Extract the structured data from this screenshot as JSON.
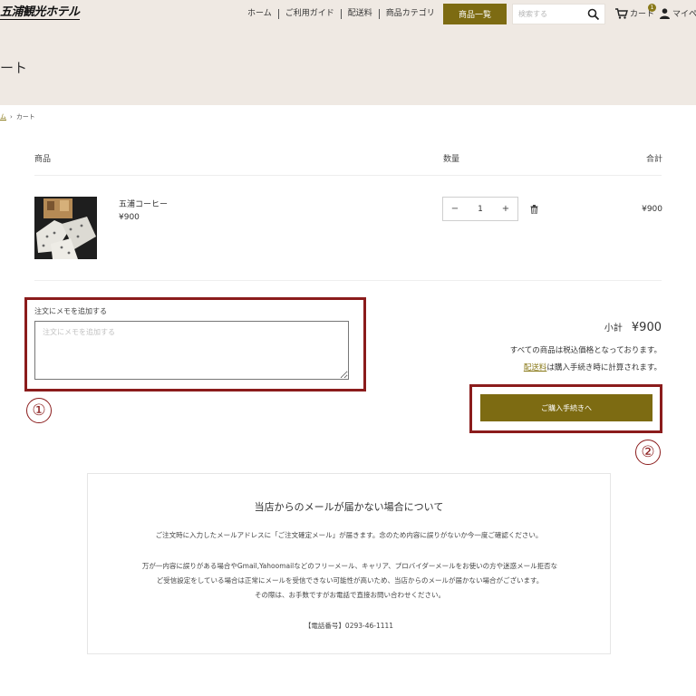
{
  "header": {
    "logo": "五浦観光ホテル",
    "nav": [
      "ホーム",
      "ご利用ガイド",
      "配送料",
      "商品カテゴリ"
    ],
    "category_button": "商品一覧",
    "search_placeholder": "検索する",
    "cart_label": "カート",
    "cart_count": "1",
    "mypage_label": "マイペ",
    "bg_color": "#efe9e3",
    "accent_color": "#7d6b12"
  },
  "page_title": "ート",
  "breadcrumb": {
    "home": "ム",
    "current": "カート"
  },
  "table": {
    "col_product": "商品",
    "col_quantity": "数量",
    "col_total": "合計"
  },
  "item": {
    "name": "五浦コーヒー",
    "price": "¥900",
    "quantity": "1",
    "total": "¥900"
  },
  "note": {
    "label": "注文にメモを追加する",
    "placeholder": "注文にメモを追加する"
  },
  "summary": {
    "subtotal_label": "小計",
    "subtotal_value": "¥900",
    "tax_note": "すべての商品は税込価格となっております。",
    "shipping_link": "配送料",
    "shipping_note": "は購入手続き時に計算されます。",
    "checkout_button": "ご購入手続きへ"
  },
  "markers": {
    "one": "①",
    "two": "②",
    "color": "#8b1c1c"
  },
  "info": {
    "title": "当店からのメールが届かない場合について",
    "p1": "ご注文時に入力したメールアドレスに「ご注文確定メール」が届きます。念のため内容に誤りがないか今一度ご確認ください。",
    "p2a": "万が一内容に誤りがある場合やGmail,Yahoomailなどのフリーメール、キャリア、プロバイダーメールをお使いの方や迷惑メール拒否な",
    "p2b": "ど受信設定をしている場合は正常にメールを受信できない可能性が高いため、当店からのメールが届かない場合がございます。",
    "p2c": "その際は、お手数ですがお電話で直接お問い合わせください。",
    "phone": "【電話番号】0293-46-1111"
  }
}
